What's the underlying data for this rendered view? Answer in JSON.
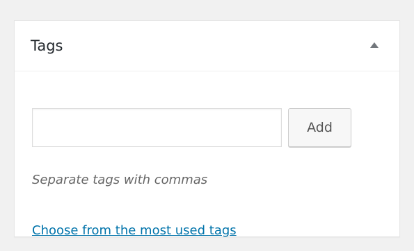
{
  "postbox": {
    "title": "Tags",
    "toggle_icon": "triangle-up-icon"
  },
  "tag_input": {
    "value": "",
    "placeholder": ""
  },
  "add_button": {
    "label": "Add"
  },
  "howto": {
    "text": "Separate tags with commas"
  },
  "tagcloud_link": {
    "text": "Choose from the most used tags"
  },
  "colors": {
    "link": "#0073aa",
    "background": "#f1f1f1",
    "panel": "#ffffff",
    "text": "#23282d",
    "muted": "#666666"
  }
}
